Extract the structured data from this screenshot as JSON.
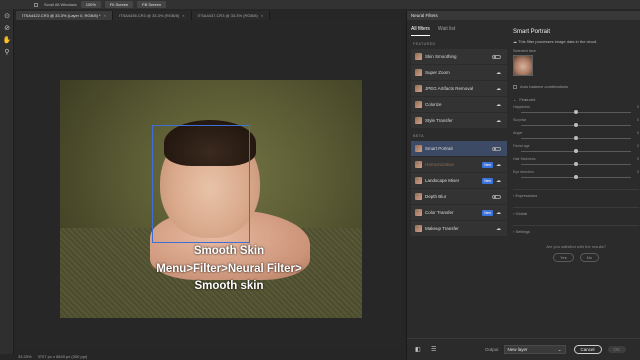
{
  "options_bar": {
    "scroll_all_label": "Scroll All Windows",
    "zoom_button": "100%",
    "fit_button": "Fit Screen",
    "fill_button": "Fill Screen"
  },
  "tabs": [
    {
      "label": "ITSA4422.CR3 @ 33.3% (Layer 0, RGB/8) *"
    },
    {
      "label": "ITSA4436.CR3 @ 33.3% (RGB/8)"
    },
    {
      "label": "ITSA4437.CR3 @ 33.3% (RGB/8)"
    }
  ],
  "caption": {
    "line1": "Smooth Skin",
    "line2": "Menu>Filter>Neural Filter>",
    "line3": "Smooth skin"
  },
  "status": {
    "zoom": "33.33%",
    "doc_info": "3707 px x 5849 px (300 ppi)"
  },
  "panel": {
    "title": "Neural Filters",
    "tab_all": "All filters",
    "tab_wait": "Wait list",
    "featured_label": "FEATURED",
    "beta_label": "BETA",
    "featured": [
      {
        "label": "Skin Smoothing",
        "control": "toggle"
      },
      {
        "label": "Super Zoom",
        "control": "cloud"
      },
      {
        "label": "JPEG Artifacts Removal",
        "control": "cloud"
      },
      {
        "label": "Colorize",
        "control": "cloud"
      },
      {
        "label": "Style Transfer",
        "control": "cloud"
      }
    ],
    "beta": [
      {
        "label": "Smart Portrait",
        "control": "toggle",
        "selected": true
      },
      {
        "label": "Harmonization",
        "control": "cloud",
        "badge": "New",
        "muted": true
      },
      {
        "label": "Landscape Mixer",
        "control": "cloud",
        "badge": "New"
      },
      {
        "label": "Depth Blur",
        "control": "toggle"
      },
      {
        "label": "Color Transfer",
        "control": "cloud",
        "badge": "New"
      },
      {
        "label": "Makeup Transfer",
        "control": "cloud"
      }
    ]
  },
  "details": {
    "title": "Smart Portrait",
    "cloud_note": "This filter processes image data in the cloud.",
    "selected_face_label": "Selected face",
    "auto_balance": "Auto balance combinations",
    "featured_label": "Featured",
    "sliders": [
      {
        "label": "Happiness",
        "value": "0",
        "level": 0.5
      },
      {
        "label": "Surprise",
        "value": "0",
        "level": 0.5
      },
      {
        "label": "Anger",
        "value": "0",
        "level": 0.5
      },
      {
        "label": "Facial age",
        "value": "0",
        "level": 0.5
      },
      {
        "label": "Hair thickness",
        "value": "0",
        "level": 0.5
      },
      {
        "label": "Eye direction",
        "value": "0",
        "level": 0.5
      }
    ],
    "expressions": "Expressions",
    "global": "Global",
    "settings": "Settings",
    "satisfied": "Are you satisfied with the results?",
    "yes": "Yes",
    "no": "No"
  },
  "footer": {
    "output_label": "Output",
    "output_value": "New layer",
    "cancel": "Cancel",
    "ok": "OK"
  }
}
